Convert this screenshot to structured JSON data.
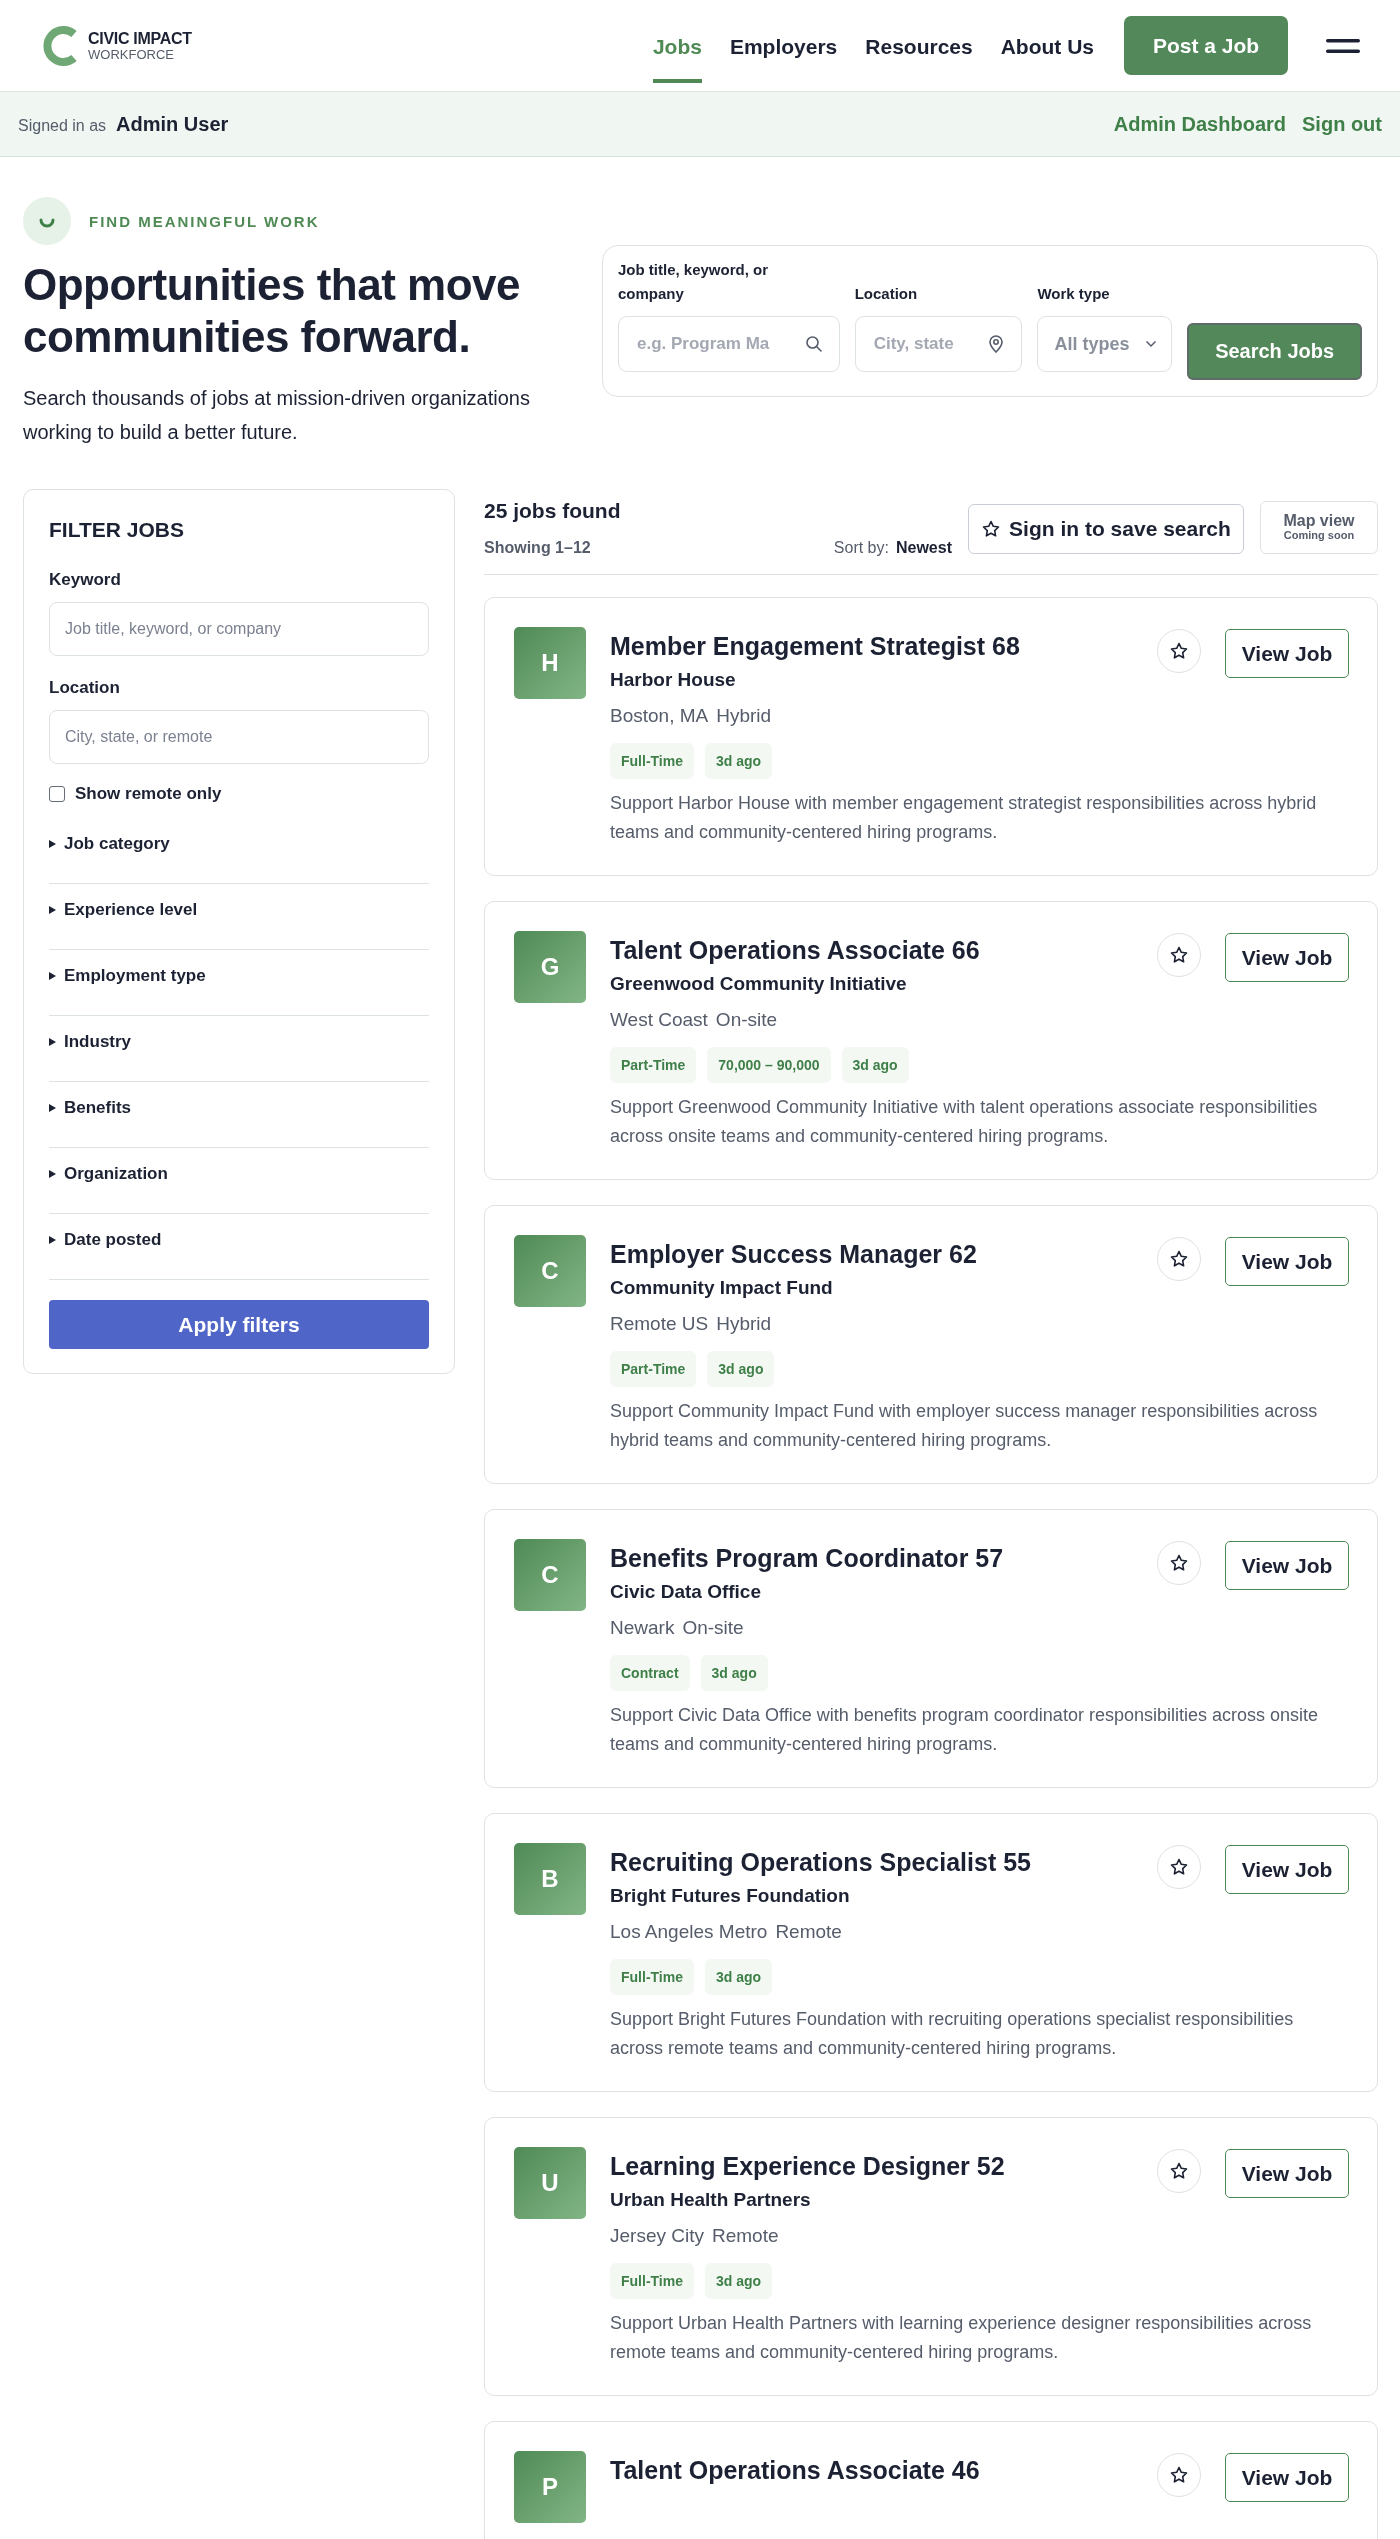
{
  "header": {
    "logo": {
      "line1": "CIVIC IMPACT",
      "line2": "WORKFORCE"
    },
    "nav": [
      {
        "label": "Jobs",
        "selected": true
      },
      {
        "label": "Employers",
        "selected": false
      },
      {
        "label": "Resources",
        "selected": false
      },
      {
        "label": "About Us",
        "selected": false
      }
    ],
    "cta": "Post a Job"
  },
  "session_bar": {
    "prefix": "Signed in as",
    "user": "Admin User",
    "links": [
      "Admin Dashboard",
      "Sign out"
    ]
  },
  "hero": {
    "eyebrow": "FIND MEANINGFUL WORK",
    "title": "Opportunities that move communities forward.",
    "subtitle": "Search thousands of jobs at mission-driven organizations working to build a better future.",
    "search": {
      "keyword": {
        "label": "Job title, keyword, or company",
        "placeholder": "e.g. Program Ma"
      },
      "location": {
        "label": "Location",
        "placeholder": "City, state"
      },
      "work_type": {
        "label": "Work type",
        "value": "All types"
      },
      "button": "Search Jobs"
    }
  },
  "filters": {
    "title": "FILTER JOBS",
    "keyword": {
      "label": "Keyword",
      "placeholder": "Job title, keyword, or company"
    },
    "location": {
      "label": "Location",
      "placeholder": "City, state, or remote"
    },
    "remote_only": {
      "label": "Show remote only",
      "checked": false
    },
    "sections": [
      {
        "label": "Job category",
        "expanded": false
      },
      {
        "label": "Experience level",
        "expanded": false
      },
      {
        "label": "Employment type",
        "expanded": false
      },
      {
        "label": "Industry",
        "expanded": false
      },
      {
        "label": "Benefits",
        "expanded": false
      },
      {
        "label": "Organization",
        "expanded": false
      },
      {
        "label": "Date posted",
        "expanded": false
      }
    ],
    "apply": "Apply filters"
  },
  "results": {
    "count": "25 jobs found",
    "showing": "Showing 1–12",
    "sort_label": "Sort by:",
    "sort_value": "Newest",
    "save_search": "Sign in to save search",
    "map_view": {
      "label": "Map view",
      "note": "Coming soon"
    },
    "jobs": [
      {
        "initial": "H",
        "title": "Member Engagement Strategist 68",
        "org": "Harbor House",
        "location": "Boston, MA",
        "mode": "Hybrid",
        "tags": [
          "Full-Time",
          "3d ago"
        ],
        "description": "Support Harbor House with member engagement strategist responsibilities across hybrid teams and community-centered hiring programs.",
        "saved": false,
        "action": "View Job"
      },
      {
        "initial": "G",
        "title": "Talent Operations Associate 66",
        "org": "Greenwood Community Initiative",
        "location": "West Coast",
        "mode": "On-site",
        "tags": [
          "Part-Time",
          "70,000 – 90,000",
          "3d ago"
        ],
        "description": "Support Greenwood Community Initiative with talent operations associate responsibilities across onsite teams and community-centered hiring programs.",
        "saved": false,
        "action": "View Job"
      },
      {
        "initial": "C",
        "title": "Employer Success Manager 62",
        "org": "Community Impact Fund",
        "location": "Remote US",
        "mode": "Hybrid",
        "tags": [
          "Part-Time",
          "3d ago"
        ],
        "description": "Support Community Impact Fund with employer success manager responsibilities across hybrid teams and community-centered hiring programs.",
        "saved": false,
        "action": "View Job"
      },
      {
        "initial": "C",
        "title": "Benefits Program Coordinator 57",
        "org": "Civic Data Office",
        "location": "Newark",
        "mode": "On-site",
        "tags": [
          "Contract",
          "3d ago"
        ],
        "description": "Support Civic Data Office with benefits program coordinator responsibilities across onsite teams and community-centered hiring programs.",
        "saved": false,
        "action": "View Job"
      },
      {
        "initial": "B",
        "title": "Recruiting Operations Specialist 55",
        "org": "Bright Futures Foundation",
        "location": "Los Angeles Metro",
        "mode": "Remote",
        "tags": [
          "Full-Time",
          "3d ago"
        ],
        "description": "Support Bright Futures Foundation with recruiting operations specialist responsibilities across remote teams and community-centered hiring programs.",
        "saved": false,
        "action": "View Job"
      },
      {
        "initial": "U",
        "title": "Learning Experience Designer 52",
        "org": "Urban Health Partners",
        "location": "Jersey City",
        "mode": "Remote",
        "tags": [
          "Full-Time",
          "3d ago"
        ],
        "description": "Support Urban Health Partners with learning experience designer responsibilities across remote teams and community-centered hiring programs.",
        "saved": false,
        "action": "View Job"
      },
      {
        "initial": "P",
        "title": "Talent Operations Associate 46",
        "saved": false,
        "action": "View Job"
      }
    ]
  }
}
